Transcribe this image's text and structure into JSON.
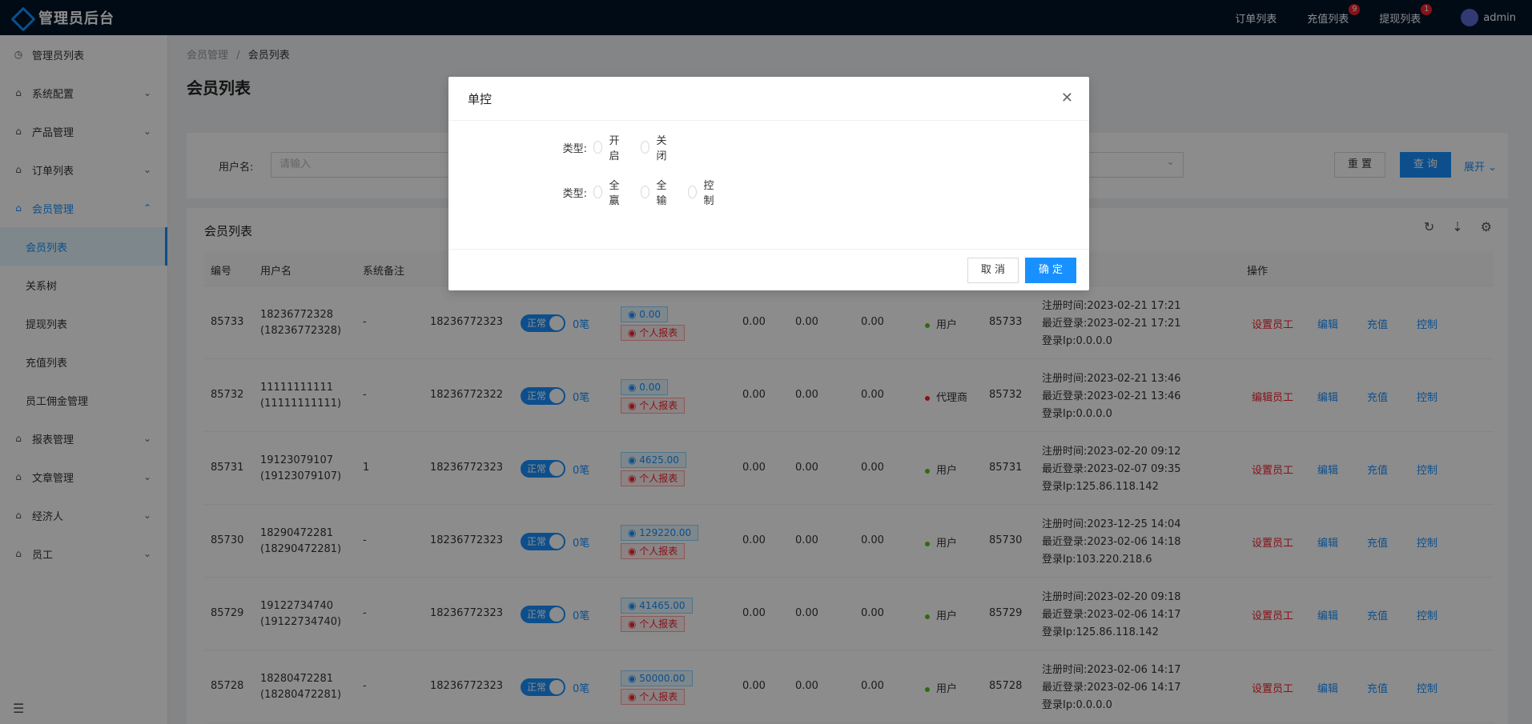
{
  "header": {
    "title": "管理员后台",
    "nav": [
      {
        "label": "订单列表",
        "badge": ""
      },
      {
        "label": "充值列表",
        "badge": "9"
      },
      {
        "label": "提现列表",
        "badge": "1"
      }
    ],
    "user": "admin"
  },
  "sidebar": {
    "items": [
      {
        "label": "管理员列表",
        "icon": "clock-icon",
        "has_arrow": false
      },
      {
        "label": "系统配置",
        "icon": "home-icon",
        "has_arrow": true
      },
      {
        "label": "产品管理",
        "icon": "home-icon",
        "has_arrow": true
      },
      {
        "label": "订单列表",
        "icon": "home-icon",
        "has_arrow": true
      },
      {
        "label": "会员管理",
        "icon": "home-icon",
        "has_arrow": true,
        "open": true
      }
    ],
    "sub_items": [
      "会员列表",
      "关系树",
      "提现列表",
      "充值列表",
      "员工佣金管理"
    ],
    "items_after": [
      {
        "label": "报表管理"
      },
      {
        "label": "文章管理"
      },
      {
        "label": "经济人"
      },
      {
        "label": "员工"
      }
    ]
  },
  "breadcrumb": {
    "parent": "会员管理",
    "separator": "/",
    "current": "会员列表"
  },
  "page_title": "会员列表",
  "search": {
    "username_label": "用户名:",
    "username_placeholder": "请输入",
    "reset": "重 置",
    "query": "查 询",
    "expand": "展开"
  },
  "table": {
    "title": "会员列表",
    "columns": [
      "编号",
      "用户名",
      "系统备注",
      "操作"
    ],
    "rows": [
      {
        "id": "85733",
        "username": "18236772328",
        "username_sub": "(18236772328)",
        "remark": "-",
        "parent": "18236772323",
        "status": "正常",
        "count": "0笔",
        "balance": "0.00",
        "report": "个人报表",
        "v1": "0.00",
        "v2": "0.00",
        "v3": "0.00",
        "role": "用户",
        "role_color": "#52c41a",
        "ref": "85733",
        "reg": "注册时间:2023-02-21 17:21",
        "last": "最近登录:2023-02-21 17:21",
        "ip": "登录Ip:0.0.0.0",
        "action1": "设置员工",
        "action1_color": "red"
      },
      {
        "id": "85732",
        "username": "11111111111",
        "username_sub": "(11111111111)",
        "remark": "-",
        "parent": "18236772322",
        "status": "正常",
        "count": "0笔",
        "balance": "0.00",
        "report": "个人报表",
        "v1": "0.00",
        "v2": "0.00",
        "v3": "0.00",
        "role": "代理商",
        "role_color": "#f5222d",
        "ref": "85732",
        "reg": "注册时间:2023-02-21 13:46",
        "last": "最近登录:2023-02-21 13:46",
        "ip": "登录Ip:0.0.0.0",
        "action1": "编辑员工",
        "action1_color": "red"
      },
      {
        "id": "85731",
        "username": "19123079107",
        "username_sub": "(19123079107)",
        "remark": "1",
        "parent": "18236772323",
        "status": "正常",
        "count": "0笔",
        "balance": "4625.00",
        "report": "个人报表",
        "v1": "0.00",
        "v2": "0.00",
        "v3": "0.00",
        "role": "用户",
        "role_color": "#52c41a",
        "ref": "85731",
        "reg": "注册时间:2023-02-20 09:12",
        "last": "最近登录:2023-02-07 09:35",
        "ip": "登录Ip:125.86.118.142",
        "action1": "设置员工",
        "action1_color": "red"
      },
      {
        "id": "85730",
        "username": "18290472281",
        "username_sub": "(18290472281)",
        "remark": "-",
        "parent": "18236772323",
        "status": "正常",
        "count": "0笔",
        "balance": "129220.00",
        "report": "个人报表",
        "v1": "0.00",
        "v2": "0.00",
        "v3": "0.00",
        "role": "用户",
        "role_color": "#52c41a",
        "ref": "85730",
        "reg": "注册时间:2023-12-25 14:04",
        "last": "最近登录:2023-02-06 14:18",
        "ip": "登录Ip:103.220.218.6",
        "action1": "设置员工",
        "action1_color": "red"
      },
      {
        "id": "85729",
        "username": "19122734740",
        "username_sub": "(19122734740)",
        "remark": "-",
        "parent": "18236772323",
        "status": "正常",
        "count": "0笔",
        "balance": "41465.00",
        "report": "个人报表",
        "v1": "0.00",
        "v2": "0.00",
        "v3": "0.00",
        "role": "用户",
        "role_color": "#52c41a",
        "ref": "85729",
        "reg": "注册时间:2023-02-20 09:18",
        "last": "最近登录:2023-02-06 14:17",
        "ip": "登录Ip:125.86.118.142",
        "action1": "设置员工",
        "action1_color": "red"
      },
      {
        "id": "85728",
        "username": "18280472281",
        "username_sub": "(18280472281)",
        "remark": "-",
        "parent": "18236772323",
        "status": "正常",
        "count": "0笔",
        "balance": "50000.00",
        "report": "个人报表",
        "v1": "0.00",
        "v2": "0.00",
        "v3": "0.00",
        "role": "用户",
        "role_color": "#52c41a",
        "ref": "85728",
        "reg": "注册时间:2023-02-06 14:17",
        "last": "最近登录:2023-02-06 14:17",
        "ip": "登录Ip:0.0.0.0",
        "action1": "设置员工",
        "action1_color": "red"
      }
    ],
    "actions": [
      "编辑",
      "充值",
      "控制"
    ]
  },
  "modal": {
    "title": "单控",
    "row1_label": "类型:",
    "row1_options": [
      "开启",
      "关闭"
    ],
    "row2_label": "类型:",
    "row2_options": [
      "全赢",
      "全输",
      "控制"
    ],
    "cancel": "取 消",
    "ok": "确 定"
  }
}
